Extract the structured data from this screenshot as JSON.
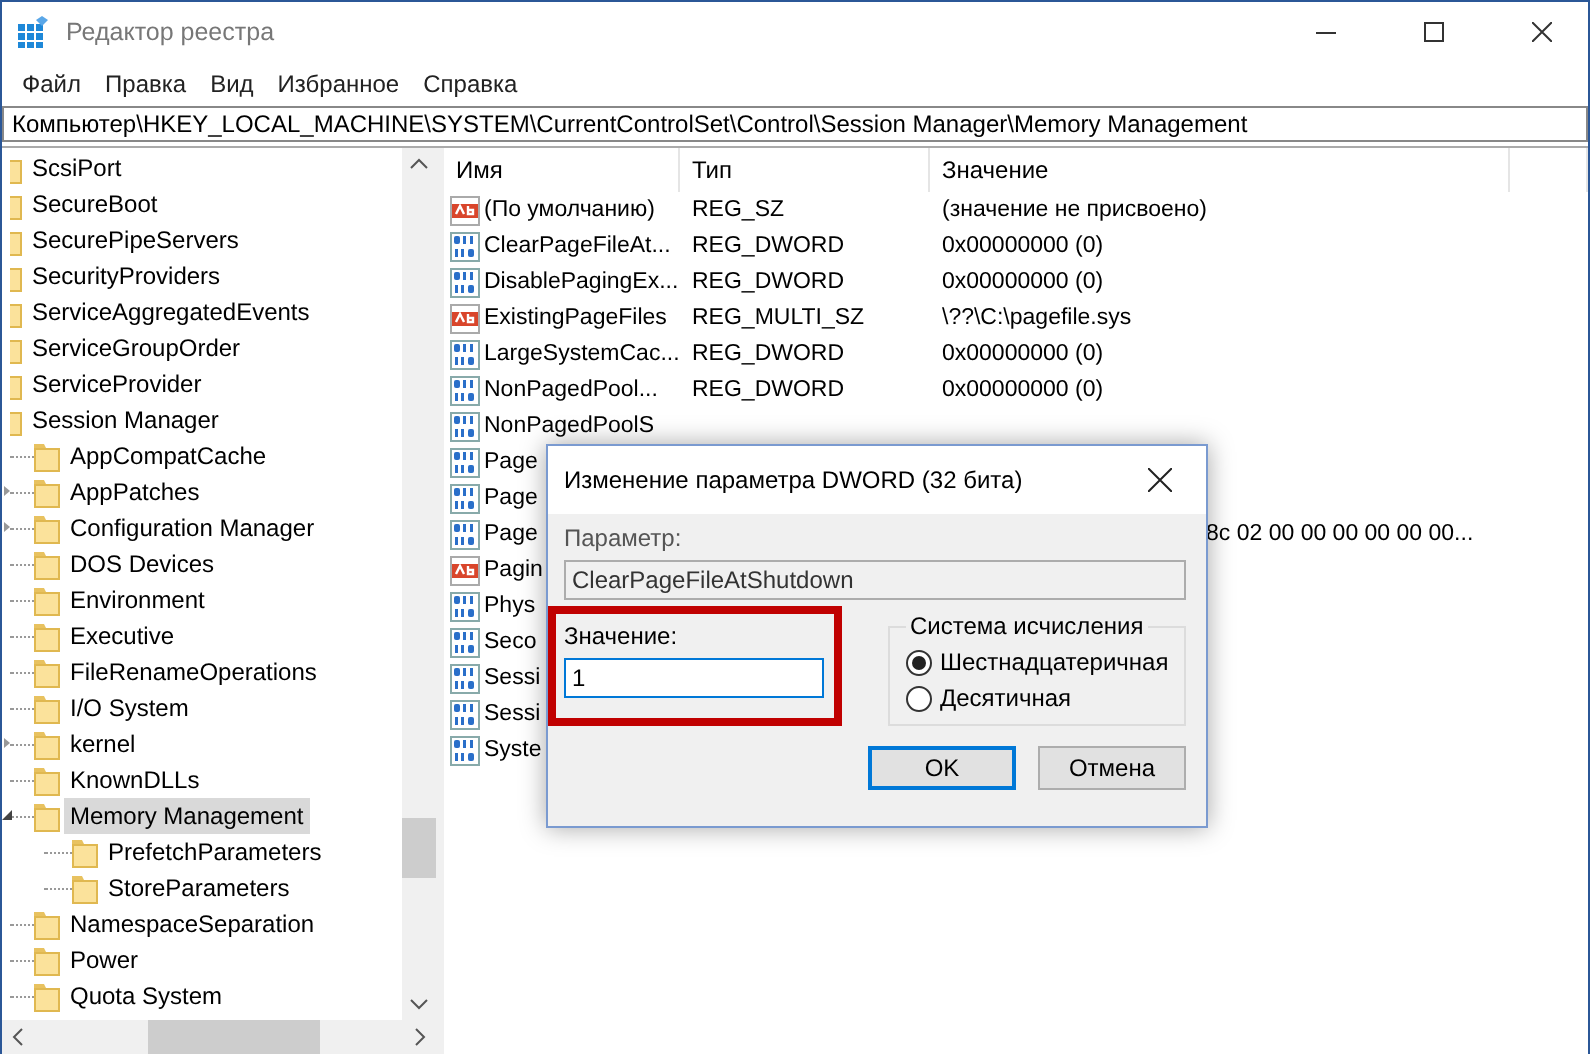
{
  "window": {
    "title": "Редактор реестра"
  },
  "menu": [
    "Файл",
    "Правка",
    "Вид",
    "Избранное",
    "Справка"
  ],
  "address_bar": {
    "value": "Компьютер\\HKEY_LOCAL_MACHINE\\SYSTEM\\CurrentControlSet\\Control\\Session Manager\\Memory Management"
  },
  "tree": {
    "items": [
      {
        "label": "ScsiPort",
        "selected": false
      },
      {
        "label": "SecureBoot",
        "selected": false
      },
      {
        "label": "SecurePipeServers",
        "selected": false
      },
      {
        "label": "SecurityProviders",
        "selected": false
      },
      {
        "label": "ServiceAggregatedEvents",
        "selected": false
      },
      {
        "label": "ServiceGroupOrder",
        "selected": false
      },
      {
        "label": "ServiceProvider",
        "selected": false
      },
      {
        "label": "Session Manager",
        "selected": false,
        "children": [
          {
            "label": "AppCompatCache",
            "selected": false
          },
          {
            "label": "AppPatches",
            "selected": false,
            "expanded": false
          },
          {
            "label": "Configuration Manager",
            "selected": false,
            "expanded": false
          },
          {
            "label": "DOS Devices",
            "selected": false
          },
          {
            "label": "Environment",
            "selected": false
          },
          {
            "label": "Executive",
            "selected": false
          },
          {
            "label": "FileRenameOperations",
            "selected": false
          },
          {
            "label": "I/O System",
            "selected": false
          },
          {
            "label": "kernel",
            "selected": false,
            "expanded": false
          },
          {
            "label": "KnownDLLs",
            "selected": false
          },
          {
            "label": "Memory Management",
            "selected": true,
            "expanded": true,
            "children": [
              {
                "label": "PrefetchParameters",
                "selected": false
              },
              {
                "label": "StoreParameters",
                "selected": false
              }
            ]
          },
          {
            "label": "NamespaceSeparation",
            "selected": false
          },
          {
            "label": "Power",
            "selected": false
          },
          {
            "label": "Quota System",
            "selected": false
          }
        ]
      }
    ]
  },
  "values": {
    "columns": [
      "Имя",
      "Тип",
      "Значение"
    ],
    "rows": [
      {
        "kind": "string",
        "name": "(По умолчанию)",
        "type": "REG_SZ",
        "value": "(значение не присвоено)"
      },
      {
        "kind": "dword",
        "name": "ClearPageFileAt...",
        "type": "REG_DWORD",
        "value": "0x00000000 (0)"
      },
      {
        "kind": "dword",
        "name": "DisablePagingEx...",
        "type": "REG_DWORD",
        "value": "0x00000000 (0)"
      },
      {
        "kind": "string",
        "name": "ExistingPageFiles",
        "type": "REG_MULTI_SZ",
        "value": "\\??\\C:\\pagefile.sys"
      },
      {
        "kind": "dword",
        "name": "LargeSystemCac...",
        "type": "REG_DWORD",
        "value": "0x00000000 (0)"
      },
      {
        "kind": "dword",
        "name": "NonPagedPool...",
        "type": "REG_DWORD",
        "value": "0x00000000 (0)"
      },
      {
        "kind": "dword",
        "name": "NonPagedPoolS"
      },
      {
        "kind": "dword",
        "name": "Page"
      },
      {
        "kind": "dword",
        "name": "Page"
      },
      {
        "kind": "dword",
        "name": "Page",
        "value": "8c 02 00 00 00 00 00 00..."
      },
      {
        "kind": "string",
        "name": "Pagin"
      },
      {
        "kind": "dword",
        "name": "Phys"
      },
      {
        "kind": "dword",
        "name": "Seco"
      },
      {
        "kind": "dword",
        "name": "Sessi"
      },
      {
        "kind": "dword",
        "name": "Sessi"
      },
      {
        "kind": "dword",
        "name": "Syste"
      }
    ]
  },
  "dialog": {
    "title": "Изменение параметра DWORD (32 бита)",
    "name_label": "Параметр:",
    "name_value": "ClearPageFileAtShutdown",
    "value_label": "Значение:",
    "value": "1",
    "base_group": {
      "title": "Система исчисления",
      "options": [
        {
          "label": "Шестнадцатеричная",
          "selected": true
        },
        {
          "label": "Десятичная",
          "selected": false
        }
      ]
    },
    "buttons": [
      {
        "label": "OK",
        "default": true
      },
      {
        "label": "Отмена",
        "default": false
      }
    ]
  }
}
